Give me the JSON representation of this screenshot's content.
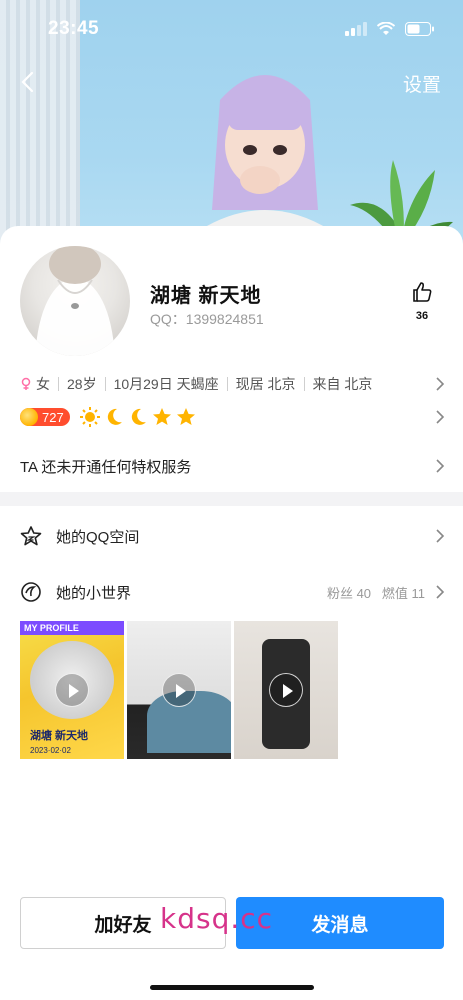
{
  "status_bar": {
    "time": "23:45",
    "icons": [
      "signal-icon",
      "wifi-icon",
      "battery-icon"
    ]
  },
  "nav": {
    "back_icon": "chevron-left-icon",
    "settings_label": "设置"
  },
  "profile": {
    "name": "湖塘  新天地",
    "qq": "QQ：1399824851",
    "likes": "36",
    "gender": "女",
    "info": [
      "28岁",
      "10月29日 天蝎座",
      "现居 北京",
      "来自 北京"
    ],
    "level_number": "727",
    "level_icons": [
      "sun-icon",
      "moon-icon",
      "moon-icon",
      "star-icon",
      "star-icon"
    ]
  },
  "privilege_text": "TA 还未开通任何特权服务",
  "qzone": {
    "label": "她的QQ空间"
  },
  "small_world": {
    "label": "她的小世界",
    "fans": "粉丝 40",
    "heat": "燃值 11",
    "videos": [
      {
        "caption": "MY PROFILE",
        "name": "湖塘  新天地",
        "date": "2023·02·02"
      },
      {
        "caption": ""
      },
      {
        "caption": ""
      }
    ]
  },
  "buttons": {
    "add_friend": "加好友",
    "send_message": "发消息"
  },
  "watermark": "kdsq.cc",
  "colors": {
    "primary_blue": "#1f8cff",
    "level_red": "#ff4d2e",
    "sky": "#a9d8f1"
  }
}
